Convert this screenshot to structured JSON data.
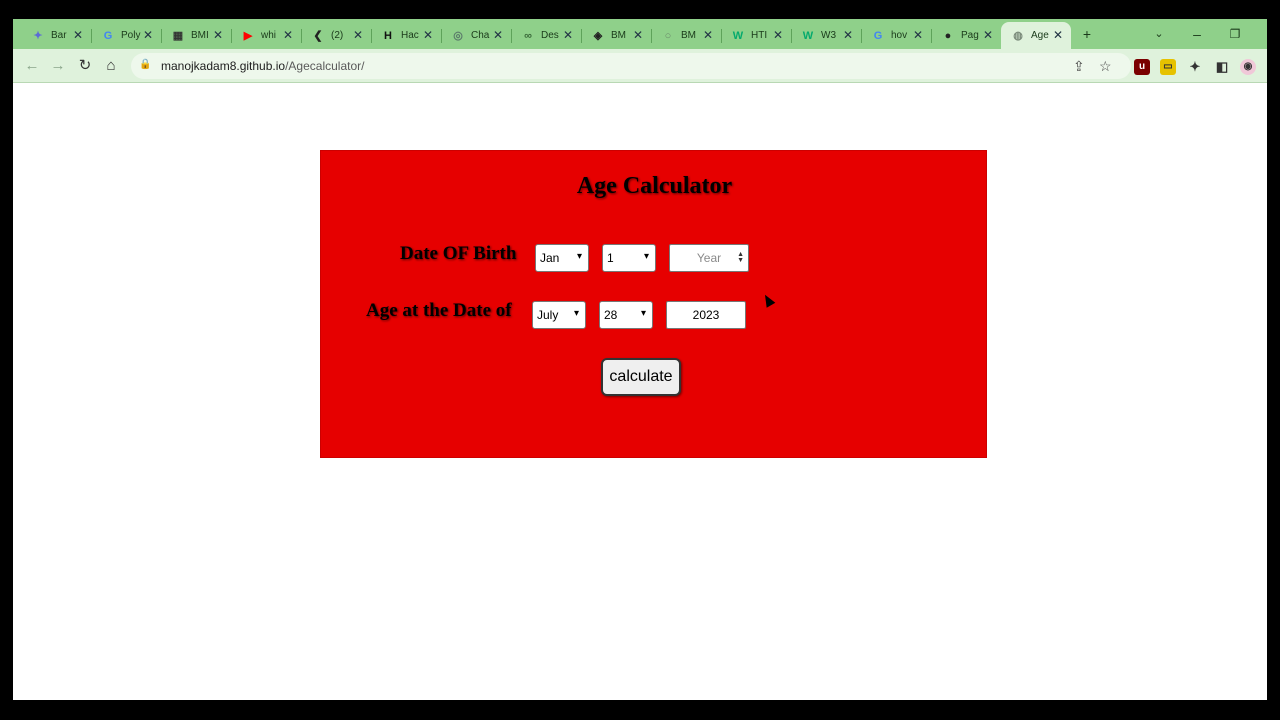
{
  "browser": {
    "tabs": [
      {
        "favicon": "✦",
        "title": "Bar",
        "color": "#5b6bd6"
      },
      {
        "favicon": "G",
        "title": "Poly",
        "color": "#4285f4"
      },
      {
        "favicon": "▦",
        "title": "BMI",
        "color": "#333333"
      },
      {
        "favicon": "▶",
        "title": "whi",
        "color": "#ff0000"
      },
      {
        "favicon": "❮",
        "title": "(2)",
        "color": "#222222"
      },
      {
        "favicon": "H",
        "title": "Hac",
        "color": "#111111"
      },
      {
        "favicon": "◎",
        "title": "Cha",
        "color": "#5a7a6a"
      },
      {
        "favicon": "∞",
        "title": "Des",
        "color": "#3a6a3a"
      },
      {
        "favicon": "◈",
        "title": "BM",
        "color": "#222222"
      },
      {
        "favicon": "○",
        "title": "BM",
        "color": "#6a8a6a"
      },
      {
        "favicon": "W",
        "title": "HTI",
        "color": "#04aa6d"
      },
      {
        "favicon": "W",
        "title": "W3",
        "color": "#04aa6d"
      },
      {
        "favicon": "G",
        "title": "hov",
        "color": "#4285f4"
      },
      {
        "favicon": "●",
        "title": "Pag",
        "color": "#222222"
      },
      {
        "favicon": "◍",
        "title": "Age",
        "color": "#7a8a7a",
        "active": true
      }
    ],
    "new_tab": "+",
    "url_host": "manojkadam8.github.io",
    "url_path": "/Agecalculator/"
  },
  "calculator": {
    "title": "Age Calculator",
    "dob_label": "Date OF Birth",
    "dob_month": "Jan",
    "dob_day": "1",
    "dob_year_placeholder": "Year",
    "age_label": "Age at the Date of",
    "age_month": "July",
    "age_day": "28",
    "age_year": "2023",
    "button": "calculate"
  }
}
